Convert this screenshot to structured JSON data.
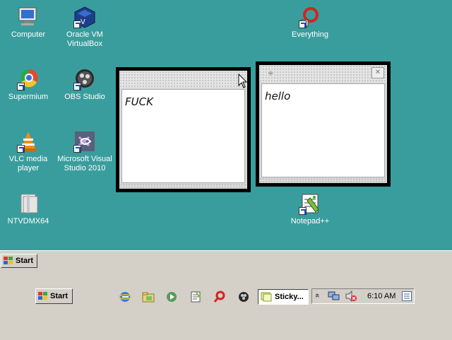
{
  "desktop": {
    "icons": [
      {
        "label": "Computer",
        "icon": "computer-icon"
      },
      {
        "label": "Oracle VM VirtualBox",
        "icon": "virtualbox-icon"
      },
      {
        "label": "Everything",
        "icon": "everything-search-icon"
      },
      {
        "label": "Supermium",
        "icon": "supermium-browser-icon"
      },
      {
        "label": "OBS Studio",
        "icon": "obs-studio-icon"
      },
      {
        "label": "VLC media player",
        "icon": "vlc-icon"
      },
      {
        "label": "Microsoft Visual Studio 2010",
        "icon": "visual-studio-icon"
      },
      {
        "label": "NTVDMX64",
        "icon": "folder-icon"
      },
      {
        "label": "Notepad++",
        "icon": "notepad-plus-plus-icon"
      }
    ]
  },
  "sticky_notes": [
    {
      "text": "FUCK"
    },
    {
      "text": "hello",
      "add_glyph": "+",
      "close_glyph": "✕"
    }
  ],
  "start_button_label": "Start",
  "taskbar": {
    "start_label": "Start",
    "quick_launch": [
      "internet-explorer-icon",
      "folder-icon",
      "media-player-icon",
      "notepad-icon",
      "search-icon",
      "obs-icon"
    ],
    "task_button_label": "Sticky...",
    "tray": {
      "expand_glyph": "«",
      "clock": "6:10 AM"
    }
  },
  "colors": {
    "desktop": "#3a9d9d",
    "taskbar": "#d4d0c8"
  }
}
